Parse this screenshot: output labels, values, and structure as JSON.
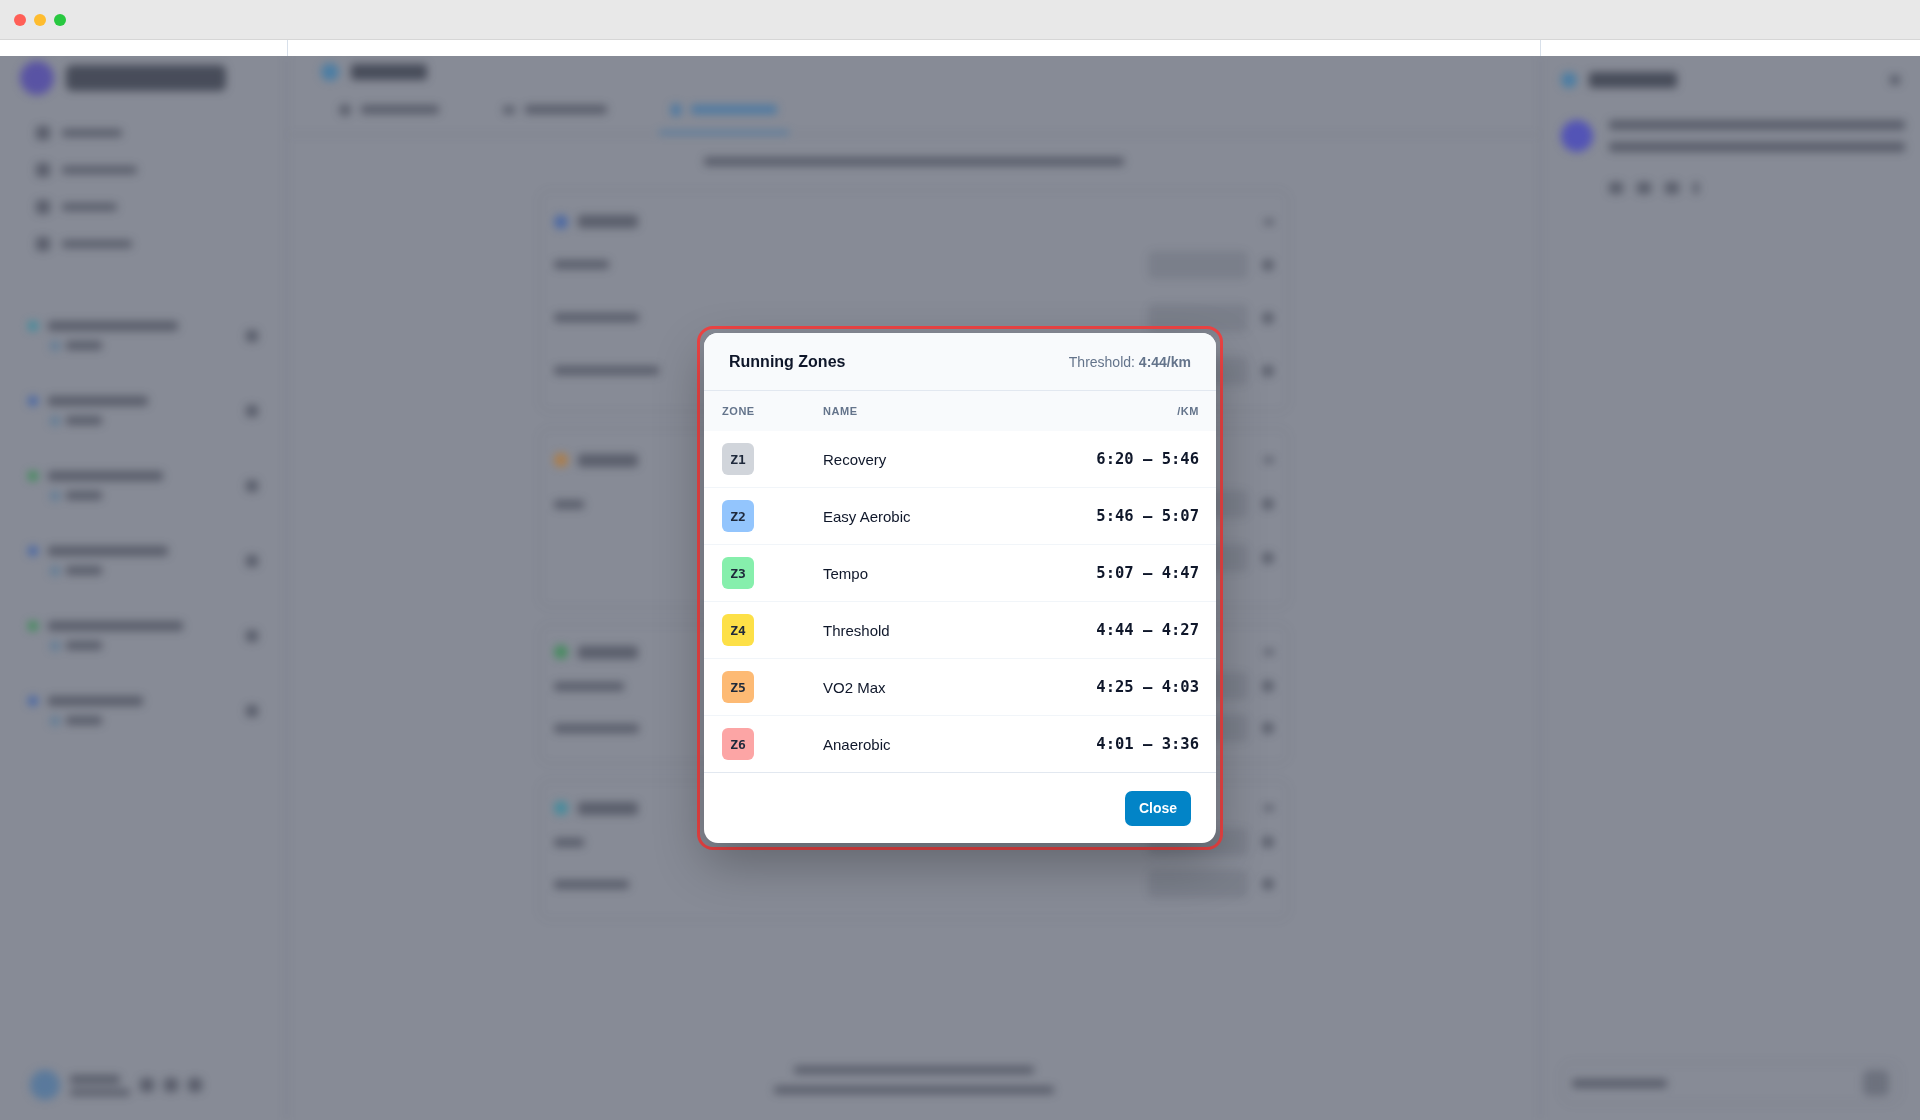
{
  "dialog": {
    "highlighted": true,
    "title": "Running Zones",
    "threshold": "Threshold: **4:44/km**",
    "columns": [
      "ZONE",
      "NAME",
      "/KM"
    ],
    "zones": [
      {
        "zone": "Z1",
        "name": "Recovery",
        "range": "6:20 – 5:46",
        "color": "#d1d5db"
      },
      {
        "zone": "Z2",
        "name": "Easy Aerobic",
        "range": "5:46 – 5:07",
        "color": "#93c5fd"
      },
      {
        "zone": "Z3",
        "name": "Tempo",
        "range": "5:07 – 4:47",
        "color": "#86efac"
      },
      {
        "zone": "Z4",
        "name": "Threshold",
        "range": "4:44 – 4:27",
        "color": "#fde047"
      },
      {
        "zone": "Z5",
        "name": "VO2 Max",
        "range": "4:25 – 4:03",
        "color": "#fdba74"
      },
      {
        "zone": "Z6",
        "name": "Anaerobic",
        "range": "4:01 – 3:36",
        "color": "#fca5a5"
      }
    ],
    "buttons": [
      "Close"
    ]
  }
}
